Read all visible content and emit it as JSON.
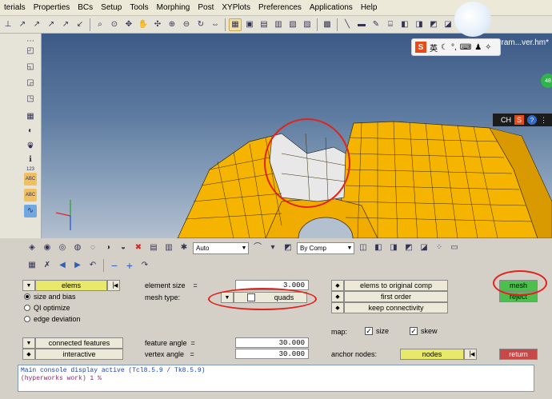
{
  "menubar": {
    "items": [
      "terials",
      "Properties",
      "BCs",
      "Setup",
      "Tools",
      "Morphing",
      "Post",
      "XYPlots",
      "Preferences",
      "Applications",
      "Help"
    ]
  },
  "viewport": {
    "model_info": "Model Info: D:/Program...ver.hm*",
    "background_top": "#3c5a86",
    "mesh_color": "#f5b400",
    "highlight_color": "#e8e8e8",
    "ime_label": "英",
    "ime_bar_label": "CH"
  },
  "panel_toolbar": {
    "auto_label": "Auto",
    "bycomp_label": "By Comp"
  },
  "panel": {
    "entity_selector": "elems",
    "options": [
      "size and bias",
      "QI optimize",
      "edge deviation"
    ],
    "selected_option": "size and bias",
    "element_size_label": "element size",
    "element_size_value": "3.000",
    "mesh_type_label": "mesh type:",
    "mesh_type_value": "quads",
    "elems_to_comp": "elems to original comp",
    "order": "first order",
    "connectivity": "keep connectivity",
    "mesh_button": "mesh",
    "reject_button": "reject",
    "return_button": "return",
    "connected_features": "connected features",
    "interactive": "interactive",
    "feature_angle_label": "feature angle",
    "feature_angle_value": "30.000",
    "vertex_angle_label": "vertex angle",
    "vertex_angle_value": "30.000",
    "map_label": "map:",
    "size_label": "size",
    "skew_label": "skew",
    "anchor_label": "anchor nodes:",
    "nodes_label": "nodes",
    "mesh_color": "#4cc04c",
    "reject_color": "#4cc04c",
    "return_color": "#c84848",
    "nodes_color": "#e8e86a"
  },
  "console": {
    "line1": "Main console display active (Tcl8.5.9 / Tk8.5.9)",
    "line2": "(hyperworks  work) 1 %"
  }
}
